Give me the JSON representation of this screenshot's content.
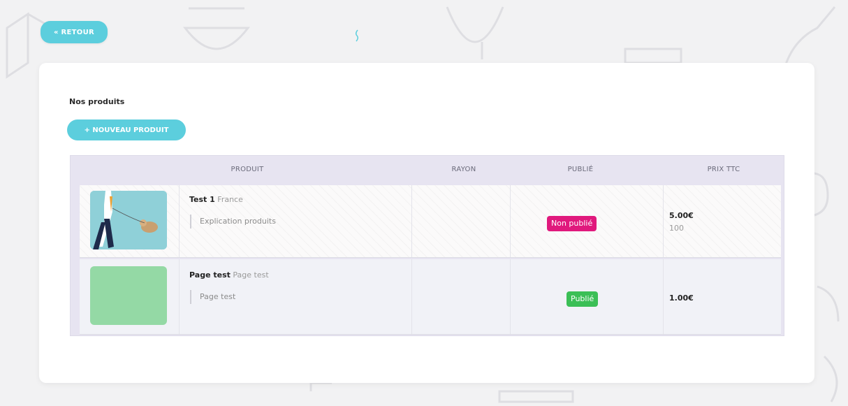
{
  "header": {
    "back_label": "« RETOUR"
  },
  "products_section": {
    "title": "Nos produits",
    "new_button_label": "+ NOUVEAU PRODUIT",
    "columns": [
      "PRODUIT",
      "RAYON",
      "PUBLIÉ",
      "PRIX TTC"
    ],
    "rows": [
      {
        "name": "Test 1",
        "subtitle": "France",
        "description": "Explication produits",
        "rayon": "",
        "status": "Non publié",
        "status_color": "#e0197d",
        "price": "5.00€",
        "stock": "100"
      },
      {
        "name": "Page test",
        "subtitle": "Page test",
        "description": "Page test",
        "rayon": "",
        "status": "Publié",
        "status_color": "#3bbf56",
        "price": "1.00€",
        "stock": ""
      }
    ]
  },
  "colors": {
    "accent": "#5ccedd",
    "table_header_bg": "#e7e4f1",
    "page_bg": "#f2f2f3"
  }
}
